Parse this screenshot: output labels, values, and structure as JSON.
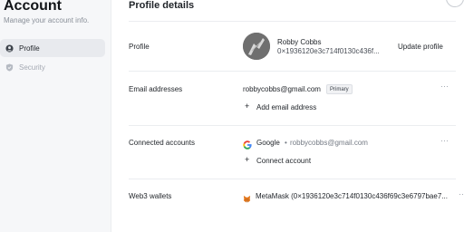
{
  "sidebar": {
    "title": "Account",
    "subtitle": "Manage your account info.",
    "items": [
      {
        "label": "Profile",
        "icon": "user-icon",
        "active": true
      },
      {
        "label": "Security",
        "icon": "shield-icon",
        "active": false
      }
    ]
  },
  "main": {
    "title": "Profile details",
    "sections": {
      "profile": {
        "label": "Profile",
        "name": "Robby Cobbs",
        "address": "0×1936120e3c714f0130c436f...",
        "action": "Update profile"
      },
      "emails": {
        "label": "Email addresses",
        "email": "robbycobbs@gmail.com",
        "badge": "Primary",
        "add": "Add email address"
      },
      "connected": {
        "label": "Connected accounts",
        "provider": "Google",
        "bullet": "•",
        "account": "robbycobbs@gmail.com",
        "connect": "Connect account"
      },
      "web3": {
        "label": "Web3 wallets",
        "wallet": "MetaMask (0×1936120e3c714f0130c436f69c3e6797bae7..."
      }
    }
  },
  "colors": {
    "sidebar_bg": "#f6f7f9",
    "active_nav_bg": "#e8eaee",
    "divider": "#ebedf0"
  }
}
